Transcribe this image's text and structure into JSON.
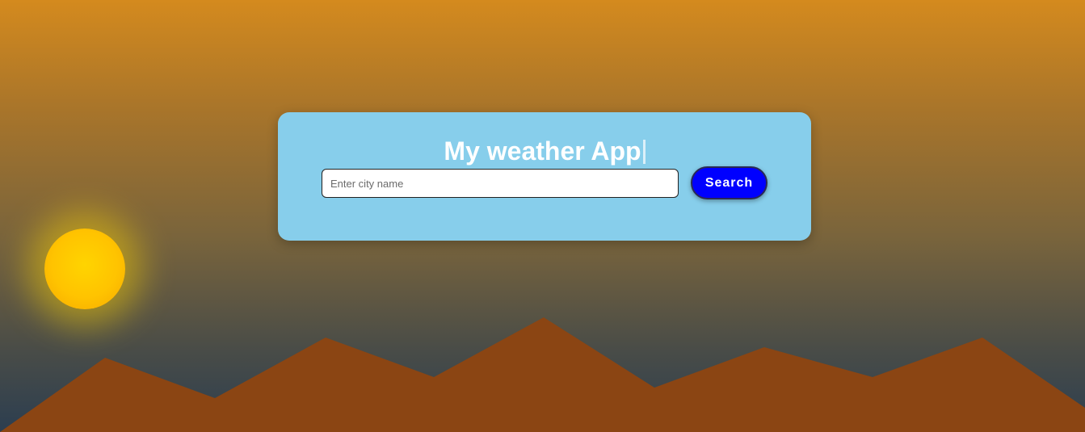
{
  "app": {
    "title": "My weather App"
  },
  "search": {
    "placeholder": "Enter city name",
    "value": "",
    "button_label": "Search"
  },
  "colors": {
    "sky_top": "#d48a1e",
    "sky_bottom": "#2c3e50",
    "card_background": "#87ceeb",
    "button_background": "#0000ff",
    "mountain": "#8b4513",
    "sun": "#ffc300"
  }
}
